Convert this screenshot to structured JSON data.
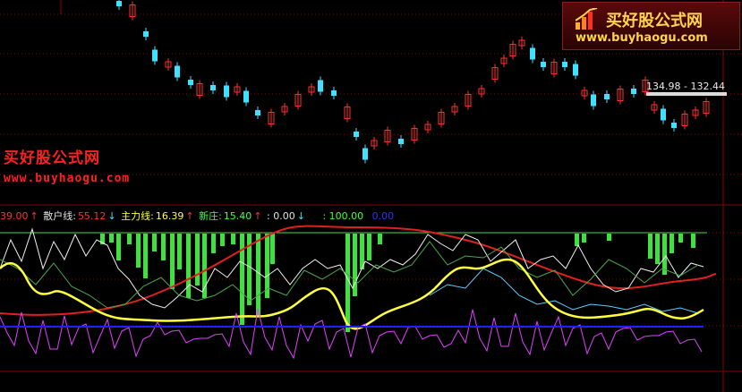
{
  "watermark": {
    "title": "买好股公式网",
    "url": "www.buyhaogu.com"
  },
  "logo": {
    "title": "买好股公式网",
    "url": "www.buyhaogu.com"
  },
  "price_range_label": "134.98 - 132.44",
  "legend": {
    "first_value": "39.00",
    "first_arrow": "↑",
    "retail_label": "散户线:",
    "retail_value": "55.12",
    "retail_arrow": "↓",
    "main_label": "主力线:",
    "main_value": "16.39",
    "main_arrow": "↑",
    "new_label": "新庄:",
    "new_value": "15.40",
    "new_arrow": "↑",
    "zero_value": ": 0.00",
    "zero_arrow": "↓",
    "hundred_value": ": 100.00",
    "blue_value": "0.00"
  },
  "colors": {
    "background": "#000000",
    "grid": "#8b0000",
    "candle_up": "#ff3030",
    "candle_down": "#40e0ff",
    "retail_line": "#ffffff",
    "main_line": "#ffff40",
    "green_bars": "#40e040",
    "trend_line": "#e02020",
    "magenta_line": "#e040ff",
    "baseline_blue": "#2020ff",
    "legend_white": "#e0e0e0",
    "legend_yellow": "#ffff40",
    "legend_green": "#40ff40",
    "legend_red": "#ff3030",
    "legend_blue": "#3030ff"
  }
}
